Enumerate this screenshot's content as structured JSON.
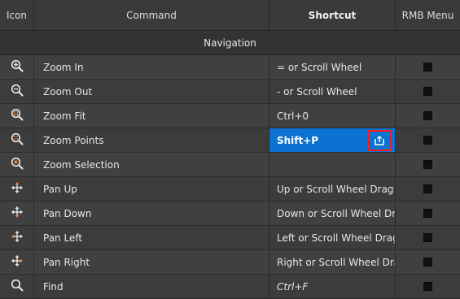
{
  "header": {
    "icon": "Icon",
    "command": "Command",
    "shortcut": "Shortcut",
    "rmb": "RMB Menu"
  },
  "group": {
    "label": "Navigation"
  },
  "rows": [
    {
      "icon": "zoom-in-icon",
      "command": "Zoom In",
      "shortcut": "= or Scroll Wheel",
      "rmb": false
    },
    {
      "icon": "zoom-out-icon",
      "command": "Zoom Out",
      "shortcut": "- or Scroll Wheel",
      "rmb": false
    },
    {
      "icon": "zoom-fit-icon",
      "command": "Zoom Fit",
      "shortcut": "Ctrl+0",
      "rmb": false
    },
    {
      "icon": "zoom-points-icon",
      "command": "Zoom Points",
      "shortcut": "Shift+P",
      "rmb": false,
      "editing": true
    },
    {
      "icon": "zoom-selection-icon",
      "command": "Zoom Selection",
      "shortcut": "",
      "rmb": false
    },
    {
      "icon": "pan-up-icon",
      "command": "Pan Up",
      "shortcut": "Up or Scroll Wheel Drag",
      "rmb": false
    },
    {
      "icon": "pan-down-icon",
      "command": "Pan Down",
      "shortcut": "Down or Scroll Wheel Drag",
      "rmb": false
    },
    {
      "icon": "pan-left-icon",
      "command": "Pan Left",
      "shortcut": "Left or Scroll Wheel Drag",
      "rmb": false
    },
    {
      "icon": "pan-right-icon",
      "command": "Pan Right",
      "shortcut": "Right or Scroll Wheel Drag",
      "rmb": false
    },
    {
      "icon": "find-icon",
      "command": "Find",
      "shortcut": "Ctrl+F",
      "rmb": false
    }
  ],
  "colors": {
    "active_bg": "#0b72d1",
    "highlight_border": "#ff1a1a",
    "icon_accent": "#e0803a"
  },
  "clear_button_icon": "clear-shortcut-icon"
}
